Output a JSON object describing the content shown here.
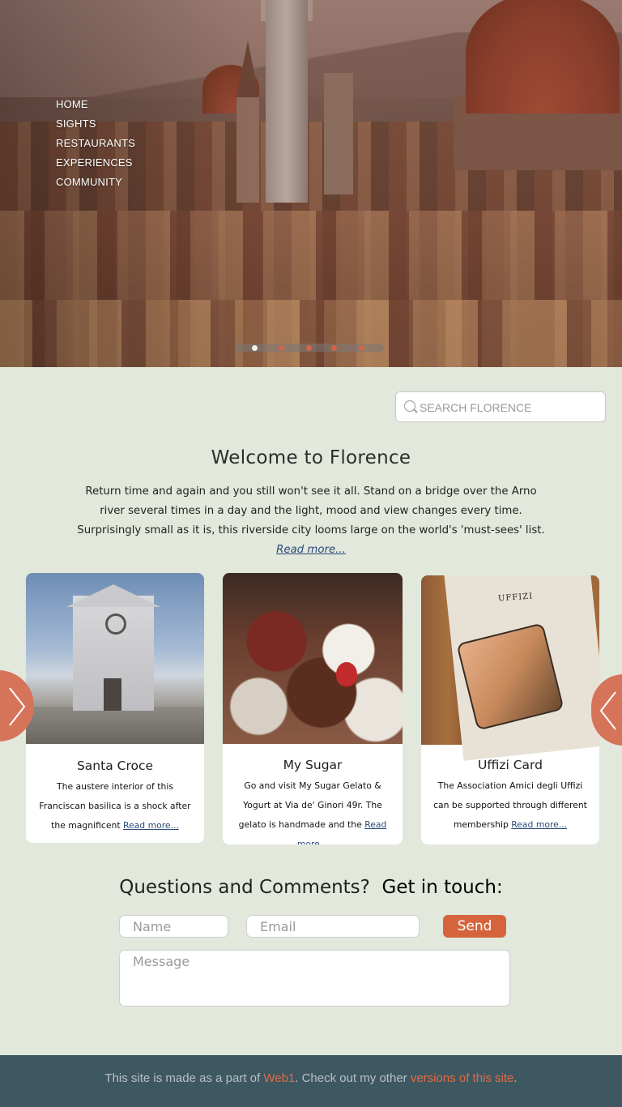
{
  "nav": {
    "items": [
      "HOME",
      "SIGHTS",
      "RESTAURANTS",
      "EXPERIENCES",
      "COMMUNITY"
    ]
  },
  "slider": {
    "dot_count": 5,
    "active_index": 0
  },
  "search": {
    "placeholder": "SEARCH FLORENCE"
  },
  "welcome": {
    "title": "Welcome to Florence",
    "text": "Return time and again and you still won't see it all. Stand on a bridge over the Arno river several times in a day and the light, mood and view changes every time. Surprisingly small as it is, this riverside city looms large on the world's 'must-sees' list.",
    "read_more": "Read more..."
  },
  "cards": [
    {
      "title": "Santa Croce",
      "text": "The austere interior of this Franciscan basilica is a shock after the magnificent",
      "read_more": "Read more..."
    },
    {
      "title": "My Sugar",
      "text": "Go and visit My Sugar Gelato & Yogurt at Via de' Ginori 49r. The gelato is handmade and the",
      "read_more": "Read more..."
    },
    {
      "title": "Uffizi Card",
      "text": "The Association Amici degli Uffizi can be supported through different membership",
      "read_more": "Read more...",
      "image_text": "UFFIZI"
    }
  ],
  "contact": {
    "title_part1": "Questions and Comments?",
    "title_part2": "Get in touch:",
    "name_placeholder": "Name",
    "email_placeholder": "Email",
    "message_placeholder": "Message",
    "send_label": "Send"
  },
  "footer": {
    "text1": "This site is made as a part of ",
    "link1": "Web1",
    "text2": ". Check out my other ",
    "link2": "versions of this site",
    "text3": "."
  },
  "colors": {
    "accent": "#d5643d",
    "background": "#e2e8dc",
    "footer": "#3e5862",
    "link": "#2a4a78"
  }
}
